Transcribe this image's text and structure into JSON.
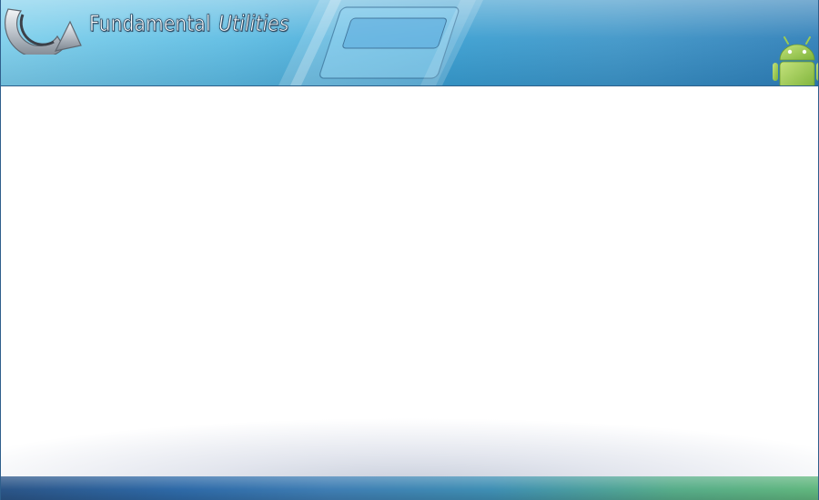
{
  "header": {
    "title_part1": "Fundamental",
    "title_part2": "Utilities",
    "logo_icon": "circular-arrow-logo-icon",
    "platform_icon": "android-icon"
  },
  "colors": {
    "header_light": "#7fd0ec",
    "header_dark": "#2f7fb8",
    "footer_start": "#2b5588",
    "footer_end": "#61b77e",
    "android_green": "#8cc63f"
  },
  "content": {},
  "footer": {}
}
